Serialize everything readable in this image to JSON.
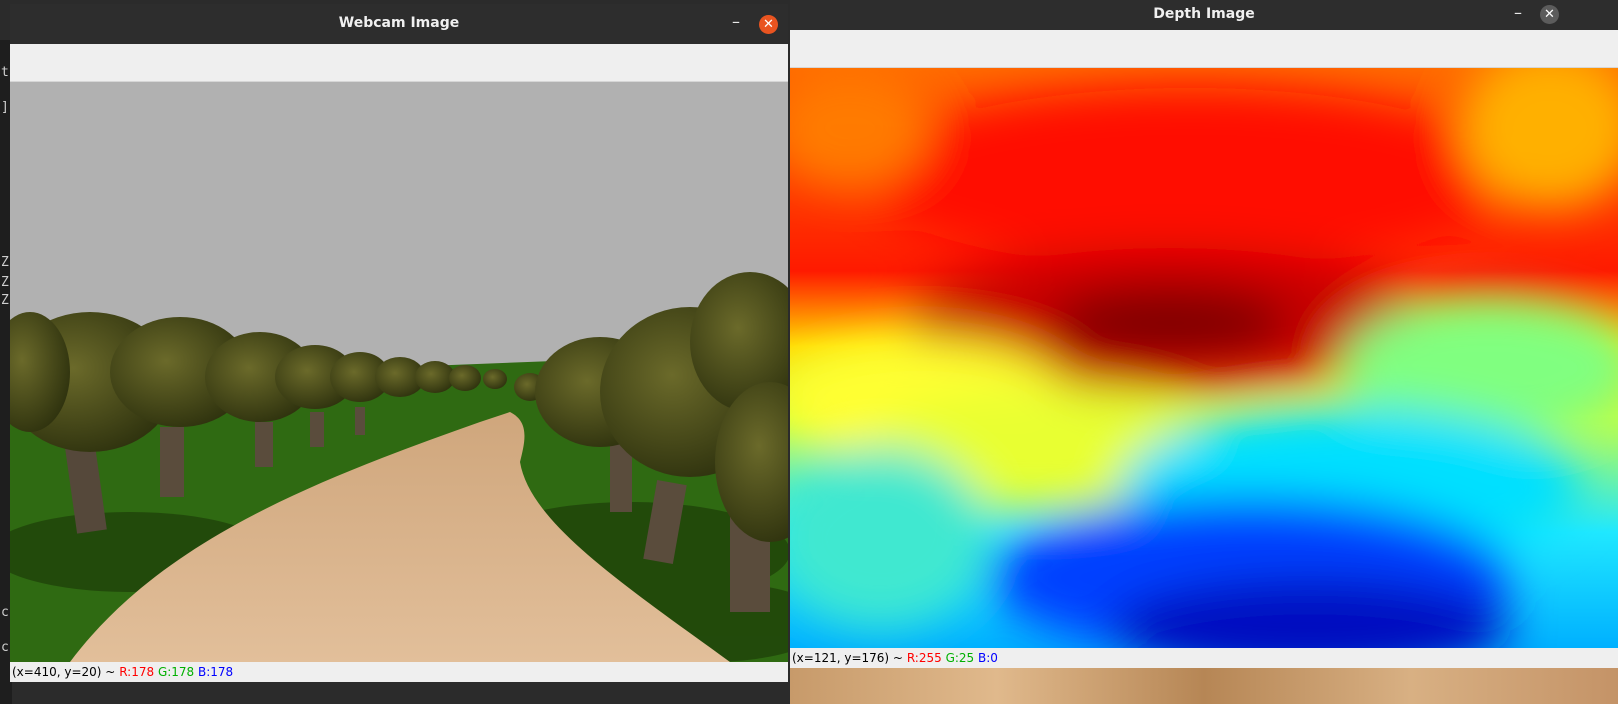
{
  "terminal": {
    "lines": [
      "t",
      "]",
      "Z",
      "Z",
      "Z",
      "c",
      "c"
    ]
  },
  "webcam_window": {
    "title": "Webcam Image",
    "minimize_glyph": "–",
    "close_glyph": "✕",
    "close_color": "#e95420",
    "status": {
      "coords": "(x=410, y=20) ~",
      "r": "R:178",
      "g": "G:178",
      "b": "B:178"
    }
  },
  "depth_window": {
    "title": "Depth Image",
    "minimize_glyph": "–",
    "close_glyph": "✕",
    "close_color": "#5c5c5c",
    "status": {
      "coords": "(x=121, y=176) ~",
      "r": "R:255",
      "g": "G:25",
      "b": "B:0"
    }
  },
  "colors": {
    "sky": "#b1b1b1",
    "grass": "#2f6a12",
    "path": "#d9b48f",
    "tree_foliage": "#3a3f12",
    "tree_trunk": "#5a4a3a"
  }
}
